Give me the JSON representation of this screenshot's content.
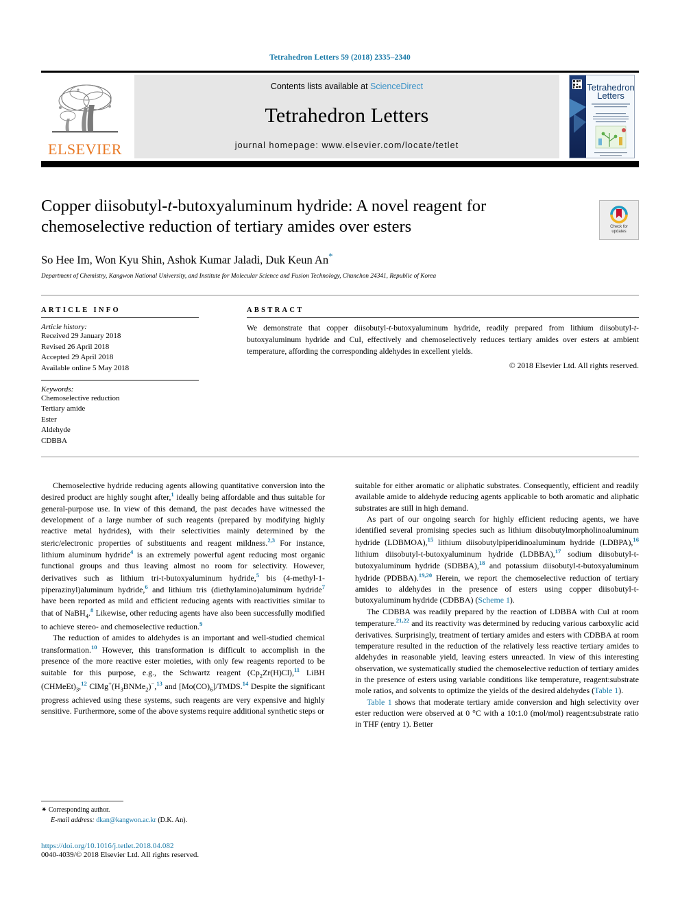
{
  "running_head": "Tetrahedron Letters 59 (2018) 2335–2340",
  "masthead": {
    "contents_prefix": "Contents lists available at ",
    "sciencedirect": "ScienceDirect",
    "journal_title": "Tetrahedron Letters",
    "homepage": "journal homepage: www.elsevier.com/locate/tetlet",
    "publisher": "ELSEVIER",
    "cover_title_line1": "Tetrahedron",
    "cover_title_line2": "Letters",
    "accent_orange": "#E87722",
    "accent_link": "#1a7aa8",
    "band_gray": "#e6e6e6"
  },
  "article": {
    "title_part1": "Copper diisobutyl-",
    "title_italic": "t",
    "title_part2": "-butoxyaluminum hydride: A novel reagent for chemoselective reduction of tertiary amides over esters",
    "authors": "So Hee Im, Won Kyu Shin, Ashok Kumar Jaladi, Duk Keun An",
    "corresponding_marker": "*",
    "affiliation": "Department of Chemistry, Kangwon National University, and Institute for Molecular Science and Fusion Technology, Chunchon 24341, Republic of Korea",
    "crossmark_line1": "Check for",
    "crossmark_line2": "updates"
  },
  "article_info": {
    "heading": "ARTICLE INFO",
    "history_label": "Article history:",
    "history": [
      "Received 29 January 2018",
      "Revised 26 April 2018",
      "Accepted 29 April 2018",
      "Available online 5 May 2018"
    ],
    "keywords_label": "Keywords:",
    "keywords": [
      "Chemoselective reduction",
      "Tertiary amide",
      "Ester",
      "Aldehyde",
      "CDBBA"
    ]
  },
  "abstract": {
    "heading": "ABSTRACT",
    "text_a": "We demonstrate that copper diisobutyl-",
    "text_italic_1": "t",
    "text_b": "-butoxyaluminum hydride, readily prepared from lithium diisobutyl-",
    "text_italic_2": "t",
    "text_c": "-butoxyaluminum hydride and CuI, effectively and chemoselectively reduces tertiary amides over esters at ambient temperature, affording the corresponding aldehydes in excellent yields.",
    "copyright": "© 2018 Elsevier Ltd. All rights reserved."
  },
  "body": {
    "left": {
      "p1_a": "Chemoselective hydride reducing agents allowing quantitative conversion into the desired product are highly sought after,",
      "p1_r1": "1",
      "p1_b": " ideally being affordable and thus suitable for general-purpose use. In view of this demand, the past decades have witnessed the development of a large number of such reagents (prepared by modifying highly reactive metal hydrides), with their selectivities mainly determined by the steric/electronic properties of substituents and reagent mildness.",
      "p1_r2": "2,3",
      "p1_c": " For instance, lithium aluminum hydride",
      "p1_r3": "4",
      "p1_d": " is an extremely powerful agent reducing most organic functional groups and thus leaving almost no room for selectivity. However, derivatives such as lithium tri-t-butoxyaluminum hydride,",
      "p1_r4": "5",
      "p1_e": " bis (4-methyl-1-piperazinyl)aluminum hydride,",
      "p1_r5": "6",
      "p1_f": " and lithium tris (diethylamino)aluminum hydride",
      "p1_r6": "7",
      "p1_g": " have been reported as mild and efficient reducing agents with reactivities similar to that of NaBH",
      "p1_sub": "4",
      "p1_h": ".",
      "p1_r7": "8",
      "p1_i": " Likewise, other reducing agents have also been successfully modified to achieve stereo- and chemoselective reduction.",
      "p1_r8": "9",
      "p2_a": "The reduction of amides to aldehydes is an important and well-studied chemical transformation.",
      "p2_r1": "10",
      "p2_b": " However, this transformation is difficult to accomplish in the presence of the more reactive ester moieties, with only few reagents reported to be suitable for this purpose, e.g., the Schwartz reagent (Cp",
      "p2_sub1": "2",
      "p2_c": "Zr(H)Cl),",
      "p2_r2": "11",
      "p2_d": " LiBH (CHMeEt)",
      "p2_sub2": "3",
      "p2_e": ",",
      "p2_r3": "12",
      "p2_f": " ClMg",
      "p2_sup1": "+",
      "p2_g": "(H",
      "p2_sub3": "3",
      "p2_h": "BNMe",
      "p2_sub4": "2",
      "p2_i": ")",
      "p2_sup2": "−",
      "p2_j": ",",
      "p2_r4": "13",
      "p2_k": " and [Mo(CO)",
      "p2_sub5": "6",
      "p2_l": "]/TMDS.",
      "p2_r5": "14",
      "p2_m": " Despite the significant progress achieved using these systems, such reagents are very expensive and highly sensitive. Furthermore, some of the above systems require additional synthetic steps or"
    },
    "right": {
      "p1": "suitable for either aromatic or aliphatic substrates. Consequently, efficient and readily available amide to aldehyde reducing agents applicable to both aromatic and aliphatic substrates are still in high demand.",
      "p2_a": "As part of our ongoing search for highly efficient reducing agents, we have identified several promising species such as lithium diisobutylmorpholinoaluminum hydride (LDBMOA),",
      "p2_r1": "15",
      "p2_b": " lithium diisobutylpiperidinoaluminum hydride (LDBPA),",
      "p2_r2": "16",
      "p2_c": " lithium diisobutyl-t-butoxyaluminum hydride (LDBBA),",
      "p2_r3": "17",
      "p2_d": " sodium diisobutyl-t-butoxyaluminum hydride (SDBBA),",
      "p2_r4": "18",
      "p2_e": " and potassium diisobutyl-t-butoxyaluminum hydride (PDBBA).",
      "p2_r5": "19,20",
      "p2_f": " Herein, we report the chemoselective reduction of tertiary amides to aldehydes in the presence of esters using copper diisobutyl-t-butoxyaluminum hydride (CDBBA) (",
      "p2_link": "Scheme 1",
      "p2_g": ").",
      "p3_a": "The CDBBA was readily prepared by the reaction of LDBBA with CuI at room temperature.",
      "p3_r1": "21,22",
      "p3_b": " and its reactivity was determined by reducing various carboxylic acid derivatives. Surprisingly, treatment of tertiary amides and esters with CDBBA at room temperature resulted in the reduction of the relatively less reactive tertiary amides to aldehydes in reasonable yield, leaving esters unreacted. In view of this interesting observation, we systematically studied the chemoselective reduction of tertiary amides in the presence of esters using variable conditions like temperature, reagent:substrate mole ratios, and solvents to optimize the yields of the desired aldehydes (",
      "p3_link": "Table 1",
      "p3_c": ").",
      "p4_link": "Table 1",
      "p4_a": " shows that moderate tertiary amide conversion and high selectivity over ester reduction were observed at 0 °C with a 10:1.0 (mol/mol) reagent:substrate ratio in THF (entry 1). Better"
    }
  },
  "footnote": {
    "star": "⁕",
    "corresponding": "Corresponding author.",
    "email_label": "E-mail address:",
    "email": "dkan@kangwon.ac.kr",
    "email_suffix": "(D.K. An).",
    "doi": "https://doi.org/10.1016/j.tetlet.2018.04.082",
    "issn": "0040-4039/© 2018 Elsevier Ltd. All rights reserved."
  }
}
